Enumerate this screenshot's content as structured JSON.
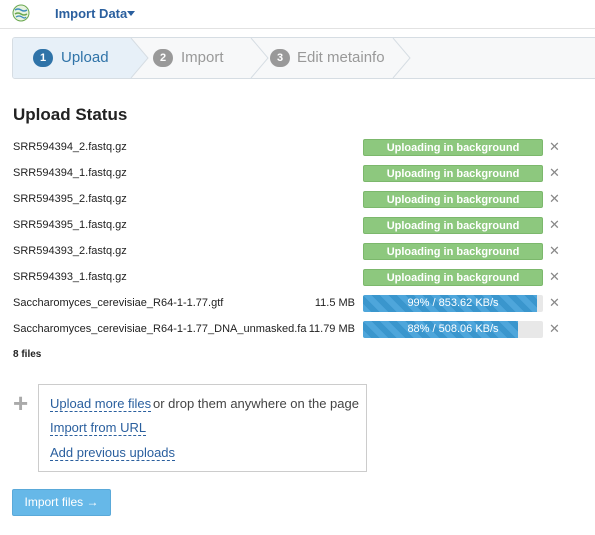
{
  "header": {
    "title": "Import Data"
  },
  "steps": [
    {
      "num": "1",
      "label": "Upload"
    },
    {
      "num": "2",
      "label": "Import"
    },
    {
      "num": "3",
      "label": "Edit metainfo"
    }
  ],
  "upload": {
    "title": "Upload Status",
    "files": [
      {
        "name": "SRR594394_2.fastq.gz",
        "size": "",
        "status": "Uploading in background",
        "progress": null
      },
      {
        "name": "SRR594394_1.fastq.gz",
        "size": "",
        "status": "Uploading in background",
        "progress": null
      },
      {
        "name": "SRR594395_2.fastq.gz",
        "size": "",
        "status": "Uploading in background",
        "progress": null
      },
      {
        "name": "SRR594395_1.fastq.gz",
        "size": "",
        "status": "Uploading in background",
        "progress": null
      },
      {
        "name": "SRR594393_2.fastq.gz",
        "size": "",
        "status": "Uploading in background",
        "progress": null
      },
      {
        "name": "SRR594393_1.fastq.gz",
        "size": "",
        "status": "Uploading in background",
        "progress": null
      },
      {
        "name": "Saccharomyces_cerevisiae_R64-1-1.77.gtf",
        "size": "11.5 MB",
        "status": "99% / 853.62 KB/s",
        "progress": 0.99
      },
      {
        "name": "Saccharomyces_cerevisiae_R64-1-1.77_DNA_unmasked.fa",
        "size": "11.79 MB",
        "status": "88% / 508.06 KB/s",
        "progress": 0.88
      }
    ],
    "count": "8 files",
    "remove_symbol": "✕"
  },
  "dropzone": {
    "plus": "+",
    "upload_more": "Upload more files",
    "drop_text": "or drop them anywhere on the page",
    "import_url": "Import from URL",
    "add_previous": "Add previous uploads"
  },
  "import_button": "Import files →"
}
